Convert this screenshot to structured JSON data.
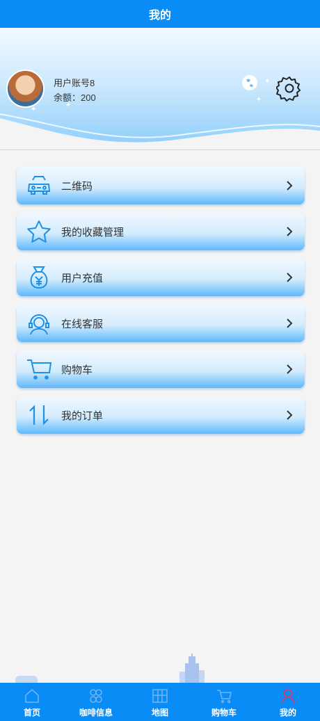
{
  "header": {
    "title": "我的"
  },
  "profile": {
    "account": "用户账号8",
    "balance": "余额：200"
  },
  "menu": {
    "items": [
      {
        "label": "二维码",
        "icon": "car-icon"
      },
      {
        "label": "我的收藏管理",
        "icon": "star-icon"
      },
      {
        "label": "用户充值",
        "icon": "money-bag-icon"
      },
      {
        "label": "在线客服",
        "icon": "headset-icon"
      },
      {
        "label": "购物车",
        "icon": "cart-icon"
      },
      {
        "label": "我的订单",
        "icon": "sort-arrows-icon"
      }
    ]
  },
  "tabbar": {
    "tabs": [
      {
        "label": "首页",
        "icon": "home-icon"
      },
      {
        "label": "咖啡信息",
        "icon": "clover-icon"
      },
      {
        "label": "地图",
        "icon": "map-icon"
      },
      {
        "label": "购物车",
        "icon": "cart-icon"
      },
      {
        "label": "我的",
        "icon": "person-icon",
        "active": true
      }
    ]
  },
  "colors": {
    "primary": "#0a8cf6",
    "icon": "#1e90e8",
    "active_tab": "#d8386a"
  }
}
